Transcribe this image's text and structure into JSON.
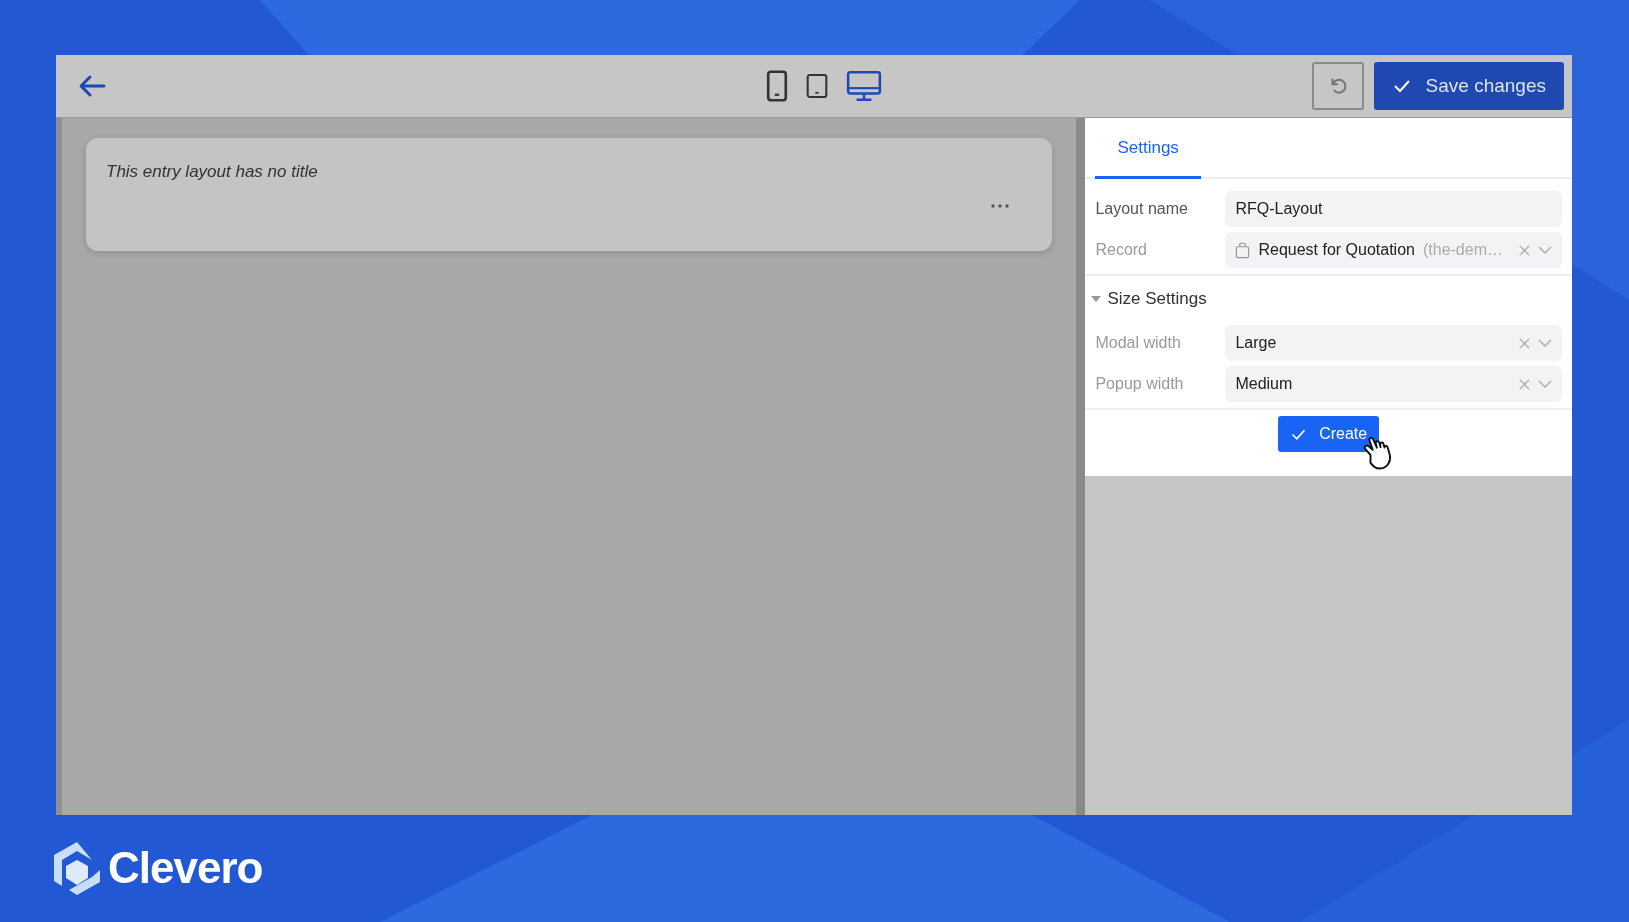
{
  "toolbar": {
    "devices": [
      {
        "kind": "phone",
        "selected": false
      },
      {
        "kind": "tablet",
        "selected": false
      },
      {
        "kind": "desktop",
        "selected": true
      }
    ],
    "save_button": "Save changes"
  },
  "canvas": {
    "card_title": "This entry layout has no title"
  },
  "settings": {
    "tabs": [
      {
        "label": "Settings",
        "selected": true
      }
    ],
    "fields": [
      {
        "label": "Layout name",
        "kind": "text",
        "value": "RFQ-Layout",
        "clearable": false
      },
      {
        "label": "Record",
        "kind": "record",
        "value": "Request for Quotation",
        "hint": "(the-dem…",
        "clearable": true
      }
    ],
    "section": {
      "title": "Size Settings",
      "expanded": true,
      "fields": [
        {
          "label": "Modal width",
          "kind": "select",
          "value": "Large",
          "clearable": true
        },
        {
          "label": "Popup width",
          "kind": "select",
          "value": "Medium",
          "clearable": true
        }
      ]
    },
    "create_button": "Create"
  },
  "brand": "Clevero"
}
